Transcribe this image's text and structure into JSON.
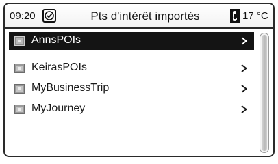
{
  "status_bar": {
    "time": "09:20",
    "clock_icon": "clock-icon",
    "title": "Pts d'intérêt  importés",
    "temperature_icon": "thermometer-icon",
    "temperature": "17 °C"
  },
  "list": {
    "items": [
      {
        "label": "AnnsPOIs",
        "icon": "poi-folder-icon",
        "selected": true
      },
      {
        "label": "KeirasPOIs",
        "icon": "poi-folder-icon",
        "selected": false
      },
      {
        "label": "MyBusinessTrip",
        "icon": "poi-folder-icon",
        "selected": false
      },
      {
        "label": "MyJourney",
        "icon": "poi-folder-icon",
        "selected": false
      }
    ]
  },
  "scrollbar": {
    "visible_fraction": 1.0
  },
  "colors": {
    "selection_background": "#141414",
    "border": "#2a2a2a"
  }
}
